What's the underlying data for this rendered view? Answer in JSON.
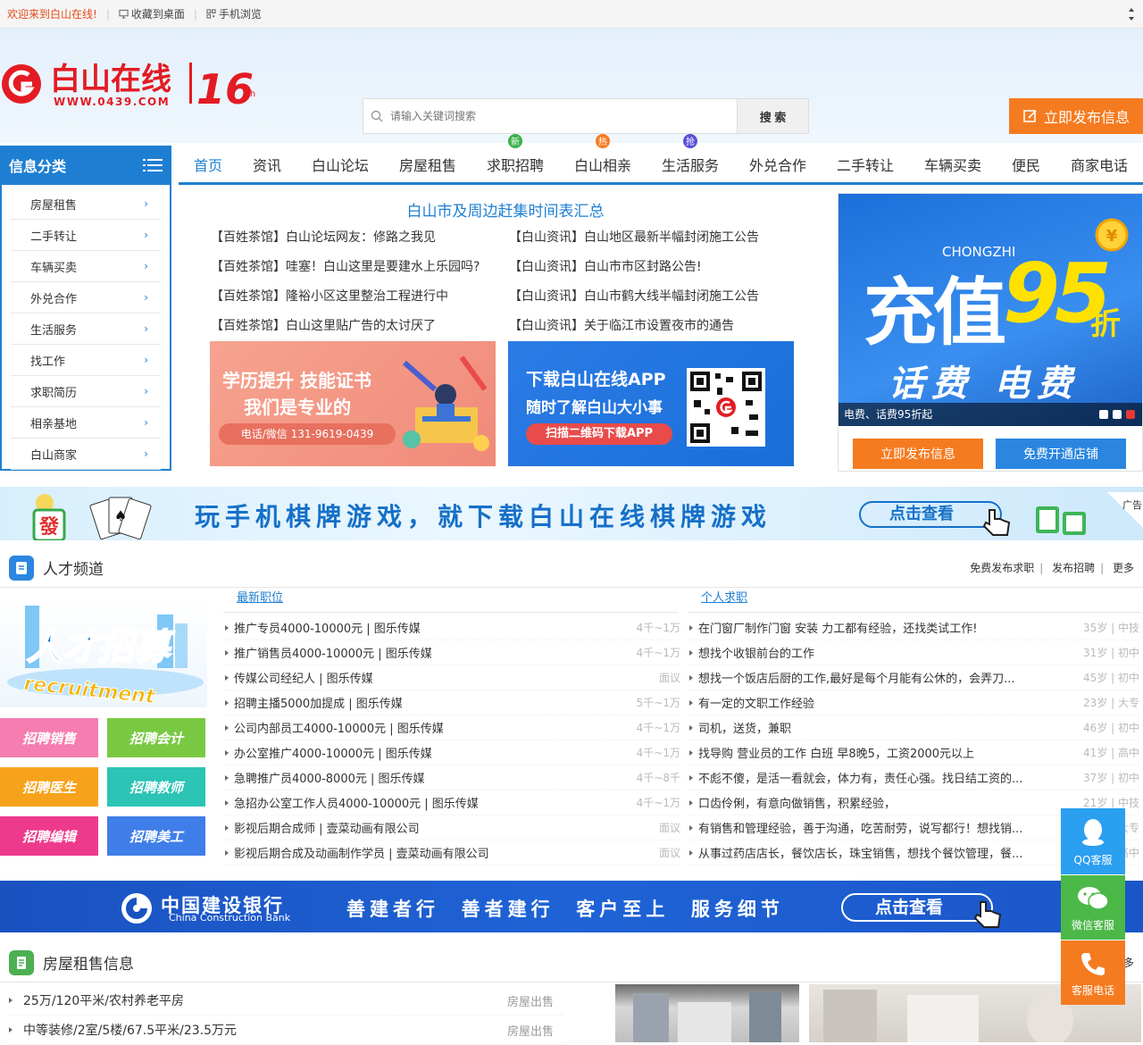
{
  "topbar": {
    "welcome": "欢迎来到白山在线!",
    "bookmark": "收藏到桌面",
    "mobile": "手机浏览"
  },
  "header": {
    "logo_text": "白山在线",
    "logo_url_text": "WWW.0439.COM",
    "logo_anniv": "16",
    "logo_anniv_suffix": "th",
    "search_placeholder": "请输入关键词搜索",
    "search_button": "搜 索",
    "publish_button": "立即发布信息"
  },
  "category": {
    "title": "信息分类",
    "items": [
      "房屋租售",
      "二手转让",
      "车辆买卖",
      "外兑合作",
      "生活服务",
      "找工作",
      "求职简历",
      "相亲基地",
      "白山商家"
    ]
  },
  "nav": {
    "items": [
      {
        "label": "首页",
        "badge": ""
      },
      {
        "label": "资讯",
        "badge": ""
      },
      {
        "label": "白山论坛",
        "badge": ""
      },
      {
        "label": "房屋租售",
        "badge": ""
      },
      {
        "label": "求职招聘",
        "badge": "新"
      },
      {
        "label": "白山相亲",
        "badge": "热"
      },
      {
        "label": "生活服务",
        "badge": "抢"
      },
      {
        "label": "外兑合作",
        "badge": ""
      },
      {
        "label": "二手转让",
        "badge": ""
      },
      {
        "label": "车辆买卖",
        "badge": ""
      },
      {
        "label": "便民",
        "badge": ""
      },
      {
        "label": "商家电话",
        "badge": ""
      }
    ]
  },
  "news": {
    "title": "白山市及周边赶集时间表汇总",
    "items": [
      "【百姓茶馆】白山论坛网友：修路之我见",
      "【白山资讯】白山地区最新半幅封闭施工公告",
      "【百姓茶馆】哇塞！白山这里是要建水上乐园吗?",
      "【白山资讯】白山市市区封路公告!",
      "【百姓茶馆】隆裕小区这里整治工程进行中",
      "【白山资讯】白山市鹤大线半幅封闭施工公告",
      "【百姓茶馆】白山这里贴广告的太讨厌了",
      "【白山资讯】关于临江市设置夜市的通告"
    ]
  },
  "banner_edu": {
    "line1": "学历提升 技能证书",
    "line2": "我们是专业的",
    "phone": "电话/微信 131-9619-0439"
  },
  "banner_app": {
    "line1": "下载白山在线APP",
    "line2": "随时了解白山大小事",
    "button": "扫描二维码下载APP"
  },
  "slide": {
    "en": "CHONGZHI",
    "big": "充值",
    "num": "95",
    "zhe": "折",
    "sub": "话费 电费",
    "caption": "电费、话费95折起"
  },
  "right_buttons": {
    "publish": "立即发布信息",
    "shop": "免费开通店铺"
  },
  "game_banner": {
    "text": "玩手机棋牌游戏，就下载白山在线棋牌游戏",
    "button": "点击查看",
    "ad": "广告",
    "tile": "發"
  },
  "talent": {
    "title": "人才频道",
    "links": [
      "免费发布求职",
      "发布招聘",
      "更多"
    ],
    "recruit_cn": "人才招募",
    "recruit_en": "recruitment",
    "tags": [
      "招聘销售",
      "招聘会计",
      "招聘医生",
      "招聘教师",
      "招聘编辑",
      "招聘美工"
    ],
    "jobs_title": "最新职位",
    "jobs": [
      {
        "t": "推广专员4000-10000元 | 图乐传媒",
        "m": "4千~1万"
      },
      {
        "t": "推广销售员4000-10000元 | 图乐传媒",
        "m": "4千~1万"
      },
      {
        "t": "传媒公司经纪人 | 图乐传媒",
        "m": "面议"
      },
      {
        "t": "招聘主播5000加提成 | 图乐传媒",
        "m": "5千~1万"
      },
      {
        "t": "公司内部员工4000-10000元 | 图乐传媒",
        "m": "4千~1万"
      },
      {
        "t": "办公室推广4000-10000元 | 图乐传媒",
        "m": "4千~1万"
      },
      {
        "t": "急聘推广员4000-8000元 | 图乐传媒",
        "m": "4千~8千"
      },
      {
        "t": "急招办公室工作人员4000-10000元 | 图乐传媒",
        "m": "4千~1万"
      },
      {
        "t": "影视后期合成师 | 壹菜动画有限公司",
        "m": "面议"
      },
      {
        "t": "影视后期合成及动画制作学员 | 壹菜动画有限公司",
        "m": "面议"
      }
    ],
    "resume_title": "个人求职",
    "resumes": [
      {
        "t": "在门窗厂制作门窗 安装 力工都有经验，还找类试工作!",
        "m": "35岁 | 中技"
      },
      {
        "t": "想找个收银前台的工作",
        "m": "31岁 | 初中"
      },
      {
        "t": "想找一个饭店后厨的工作,最好是每个月能有公休的，会弄刀...",
        "m": "45岁 | 初中"
      },
      {
        "t": "有一定的文职工作经验",
        "m": "23岁 | 大专"
      },
      {
        "t": "司机，送货，兼职",
        "m": "46岁 | 初中"
      },
      {
        "t": "找导购 营业员的工作 白班 早8晚5，工资2000元以上",
        "m": "41岁 | 高中"
      },
      {
        "t": "不彪不傻，是活一看就会，体力有，责任心强。找日结工资的...",
        "m": "37岁 | 初中"
      },
      {
        "t": "口齿伶俐，有意向做销售，积累经验，",
        "m": "21岁 | 中技"
      },
      {
        "t": "有销售和管理经验，善于沟通，吃苦耐劳，说写都行！想找销...",
        "m": "27岁 | 大专"
      },
      {
        "t": "从事过药店店长，餐饮店长，珠宝销售，想找个餐饮管理，餐...",
        "m": "40岁 | 高中"
      }
    ]
  },
  "ccb": {
    "name_cn": "中国建设银行",
    "name_en": "China Construction Bank",
    "slogan": "善建者行  善者建行  客户至上  服务细节",
    "button": "点击查看"
  },
  "house": {
    "title": "房屋租售信息",
    "more": "多",
    "items": [
      {
        "t": "25万/120平米/农村养老平房",
        "m": "房屋出售"
      },
      {
        "t": "中等装修/2室/5楼/67.5平米/23.5万元",
        "m": "房屋出售"
      }
    ]
  },
  "float": {
    "qq": "QQ客服",
    "wechat": "微信客服",
    "phone": "客服电话"
  },
  "colors": {
    "blue": "#1e7fd2",
    "orange": "#f57b20",
    "red": "#e53935"
  }
}
